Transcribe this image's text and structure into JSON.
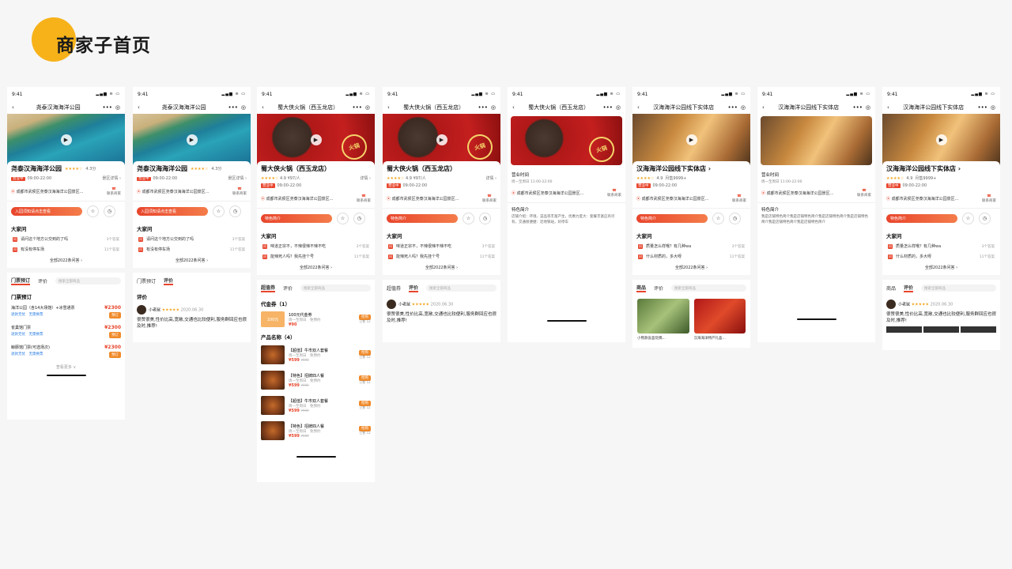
{
  "page_title": "商家子首页",
  "status_time": "9:41",
  "status_icons": "▂▄▆ ≋ ▭",
  "icons": {
    "back": "‹",
    "more": "•••",
    "target": "◎",
    "play": "▶",
    "star": "☆",
    "clock": "◷",
    "phone": "☎",
    "pin": "⦿"
  },
  "colors": {
    "accent": "#e8452c",
    "orange": "#f08a2a",
    "title_circle": "#f7b21a"
  },
  "screens": {
    "s1": {
      "nav_title": "尧泰汉海海洋公园",
      "shop_name": "尧泰汉海海洋公园",
      "stars": "★★★★☆",
      "score": "4.3分",
      "tag": "营业中",
      "hours": "09:00-22:00",
      "detail": "景区详情 ›",
      "address": "成都市武侯区尧泰汉海海洋公园景区...",
      "contact": "联系商家",
      "pill": "入园须知请点击查看",
      "section_qa": "大家问",
      "q1": "请问这个地方公交到的了吗",
      "q1c": "3个答案",
      "q2": "有没有停车场",
      "q2c": "11个答案",
      "qa_more": "全部2022条问答 ›",
      "tab1": "门票预订",
      "tab2": "评价",
      "search": "搜索全部商品",
      "section_ticket": "门票预订",
      "t1": "海洋公园（含14大场馆）+冰雪通票",
      "t1p": "¥2300",
      "t1s": "退款无忧　无需换票",
      "t2": "雀巢馆门票",
      "t2p": "¥2300",
      "t2s": "退款无忧　无需换票",
      "t3": "鲸豚馆门票(可选场次)",
      "t3p": "¥2300",
      "t3s": "退款无忧　无需换票",
      "btn": "预订",
      "sold": "已售 12",
      "view_more": "查看更多 ∨"
    },
    "s2": {
      "nav_title": "尧泰汉海海洋公园",
      "shop_name": "尧泰汉海海洋公园",
      "stars": "★★★★☆",
      "score": "4.3分",
      "tag": "营业中",
      "hours": "09:00-22:00",
      "detail": "景区详情 ›",
      "address": "成都市武侯区尧泰汉海海洋公园景区...",
      "contact": "联系商家",
      "pill": "入园须知请点击查看",
      "section_qa": "大家问",
      "q1": "请问这个地方公交到的了吗",
      "q1c": "3个答案",
      "q2": "有没有停车场",
      "q2c": "11个答案",
      "qa_more": "全部2022条问答 ›",
      "tab1": "门票预订",
      "tab2": "评价",
      "section_review": "评价",
      "reviewer": "小老鼠",
      "rstars": "★★★★★",
      "rdate": "2020.06.30",
      "review": "很赞很美,性价比高,宽敞,交通也比较便利,服务群回应也很及时,推荐!"
    },
    "s3": {
      "nav_title": "蜀大侠火锅（西玉龙店）",
      "shop_name": "蜀大侠火锅（西玉龙店）",
      "stars": "★★★★☆",
      "score": "4.9",
      "per": "¥97/人",
      "detail": "详情 ›",
      "tag": "营业中",
      "hours": "09:00-22:00",
      "stamp": "火锅",
      "address": "成都市武侯区尧泰汉海海洋公园景区...",
      "contact": "联系商家",
      "pill": "特色简介",
      "section_qa": "大家问",
      "q1": "味道正宗不，不辣很辣不辣不吃",
      "q1c": "3个答案",
      "q2": "能辣死人吗？我先挂个号",
      "q2c": "11个答案",
      "qa_more": "全部2022条问答 ›",
      "tab1": "超值券",
      "tab2": "评价",
      "search": "搜索全部商品",
      "section_coupon": "代金券（1）",
      "coupon_box": "100元",
      "coupon_name": "100元代金券",
      "coupon_sub": "周一至周日　免预约",
      "coupon_price": "¥90",
      "btn": "抢购",
      "sold": "已售 12",
      "section_prod": "产品名称（4）",
      "p1": "【超值】牛市双人套餐",
      "p2": "【特色】招牌四人餐",
      "p3": "【超值】牛市双人套餐",
      "p4": "【特色】招牌四人餐",
      "psub": "周一至周日　免预约",
      "pprice": "¥599",
      "porig": "¥999"
    },
    "s4": {
      "nav_title": "蜀大侠火锅（西玉龙店）",
      "shop_name": "蜀大侠火锅（西玉龙店）",
      "stars": "★★★★☆",
      "score": "4.9",
      "per": "¥97/人",
      "detail": "详情 ›",
      "tag": "营业中",
      "hours": "09:00-22:00",
      "stamp": "火锅",
      "address": "成都市武侯区尧泰汉海海洋公园景区...",
      "contact": "联系商家",
      "pill": "特色简介",
      "section_qa": "大家问",
      "q1": "味道正宗不，不辣很辣不辣不吃",
      "q1c": "3个答案",
      "q2": "能辣死人吗？我先挂个号",
      "q2c": "11个答案",
      "qa_more": "全部2022条问答 ›",
      "tab1": "超值券",
      "tab2": "评价",
      "search": "搜索全部商品",
      "reviewer": "小老鼠",
      "rstars": "★★★★★",
      "rdate": "2020.06.30",
      "review": "很赞很美,性价比高,宽敞,交通也比较便利,服务群回应也很及时,推荐!"
    },
    "s5": {
      "nav_title": "蜀大侠火锅（西玉龙店）",
      "stamp": "火锅",
      "hours_label": "营业时间",
      "hours": "周一至周日 11:00-22:00",
      "address": "成都市武侯区尧泰汉海海洋公园景区...",
      "contact": "联系商家",
      "intro_label": "特色简介",
      "intro": "店铺介绍：环境、菜品等丰富产生，优惠力度大：套餐丰富应有尽有，交通很便捷：近地铁站，好停车"
    },
    "s6": {
      "nav_title": "汉海海洋公园线下实体店",
      "shop_name": "汉海海洋公园线下实体店 ›",
      "stars": "★★★★☆",
      "score": "4.9",
      "per": "月售9999+",
      "tag": "营业中",
      "hours": "09:00-22:00",
      "address": "成都市武侯区尧泰汉海海洋公园景区...",
      "contact": "联系商家",
      "pill": "特色简介",
      "section_qa": "大家问",
      "q1": "质量怎么样哦？有几种wa",
      "q1c": "3个答案",
      "q2": "什么材质的，多大呀",
      "q2c": "11个答案",
      "qa_more": "全部2022条问答 ›",
      "tab1": "商品",
      "tab2": "评价",
      "search": "搜索全部商品",
      "g1": "小熊款盲盒玩偶...",
      "g2": "汉海海洋特产礼盒..."
    },
    "s7": {
      "nav_title": "汉海海洋公园线下实体店",
      "hours_label": "营业时间",
      "hours": "周一至周日 11:00-22:00",
      "address": "成都市武侯区尧泰汉海海洋公园景区...",
      "contact": "联系商家",
      "intro_label": "特色简介",
      "intro": "我是店铺特色简介我是店铺特色简介我是店铺特色简介我是店铺特色简介我是店铺特色简介我是店铺特色简介"
    },
    "s8": {
      "nav_title": "汉海海洋公园线下实体店",
      "shop_name": "汉海海洋公园线下实体店 ›",
      "stars": "★★★★☆",
      "score": "4.9",
      "per": "月售9999+",
      "tag": "营业中",
      "hours": "09:00-22:00",
      "address": "成都市武侯区尧泰汉海海洋公园景区...",
      "contact": "联系商家",
      "pill": "特色简介",
      "section_qa": "大家问",
      "q1": "质量怎么样哦？有几种wa",
      "q1c": "3个答案",
      "q2": "什么材质的，多大呀",
      "q2c": "11个答案",
      "qa_more": "全部2022条问答 ›",
      "tab1": "商品",
      "tab2": "评价",
      "search": "搜索全部商品",
      "reviewer": "小老鼠",
      "rstars": "★★★★★",
      "rdate": "2020.06.30",
      "review": "很赞很美,性价比高,宽敞,交通也比较便利,服务群回应也很及时,推荐!"
    }
  }
}
